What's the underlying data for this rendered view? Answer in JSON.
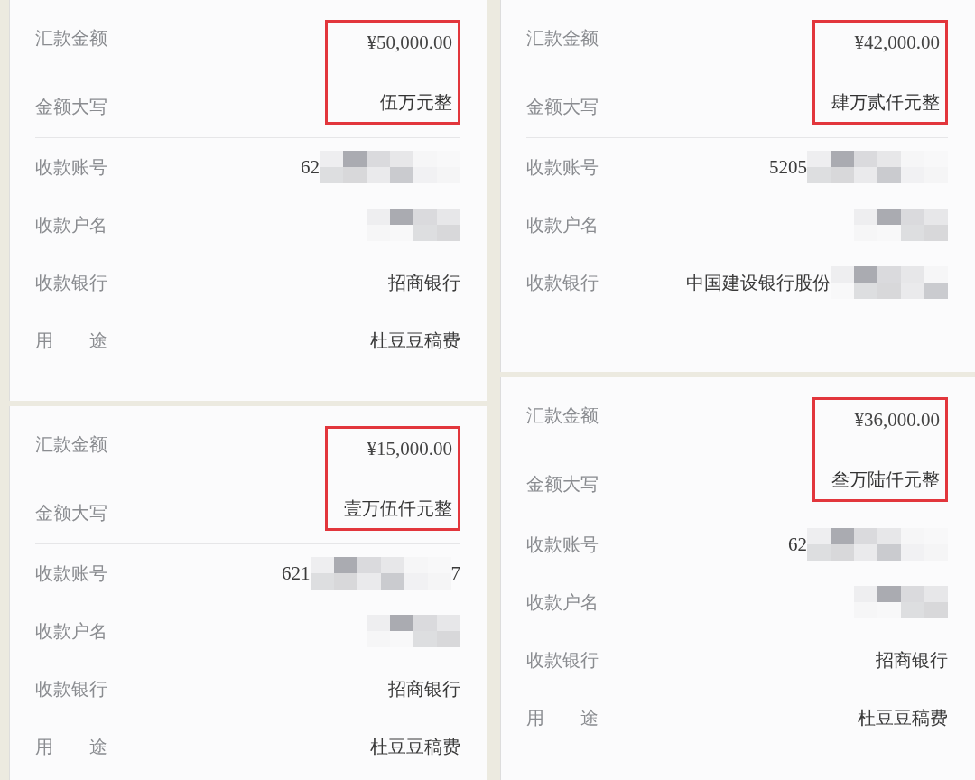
{
  "receipts": [
    {
      "amount": {
        "label": "汇款金额",
        "value": "¥50,000.00"
      },
      "words": {
        "label": "金额大写",
        "value": "伍万元整"
      },
      "rows": [
        {
          "kind": "number",
          "label": "收款账号",
          "value": "62",
          "redacted": true
        },
        {
          "kind": "text",
          "label": "收款户名",
          "redacted": true
        },
        {
          "kind": "text",
          "label": "收款银行",
          "value": "招商银行"
        },
        {
          "kind": "text",
          "label": "用　　途",
          "value": "杜豆豆稿费"
        }
      ]
    },
    {
      "amount": {
        "label": "汇款金额",
        "value": "¥15,000.00"
      },
      "words": {
        "label": "金额大写",
        "value": "壹万伍仟元整"
      },
      "rows": [
        {
          "kind": "number",
          "label": "收款账号",
          "value": "621",
          "suffix": "7",
          "redacted": true
        },
        {
          "kind": "text",
          "label": "收款户名",
          "redacted": true
        },
        {
          "kind": "text",
          "label": "收款银行",
          "value": "招商银行"
        },
        {
          "kind": "text",
          "label": "用　　途",
          "value": "杜豆豆稿费"
        }
      ]
    },
    {
      "amount": {
        "label": "汇款金额",
        "value": "¥42,000.00"
      },
      "words": {
        "label": "金额大写",
        "value": "肆万贰仟元整"
      },
      "rows": [
        {
          "kind": "number",
          "label": "收款账号",
          "value": "5205",
          "redacted": true
        },
        {
          "kind": "text",
          "label": "收款户名",
          "redacted": true
        },
        {
          "kind": "text",
          "label": "收款银行",
          "value": "中国建设银行股份",
          "redacted": true
        }
      ]
    },
    {
      "amount": {
        "label": "汇款金额",
        "value": "¥36,000.00"
      },
      "words": {
        "label": "金额大写",
        "value": "叁万陆仟元整"
      },
      "rows": [
        {
          "kind": "number",
          "label": "收款账号",
          "value": "62",
          "redacted": true
        },
        {
          "kind": "text",
          "label": "收款户名",
          "redacted": true
        },
        {
          "kind": "text",
          "label": "收款银行",
          "value": "招商银行"
        },
        {
          "kind": "text",
          "label": "用　　途",
          "value": "杜豆豆稿费"
        }
      ]
    }
  ]
}
